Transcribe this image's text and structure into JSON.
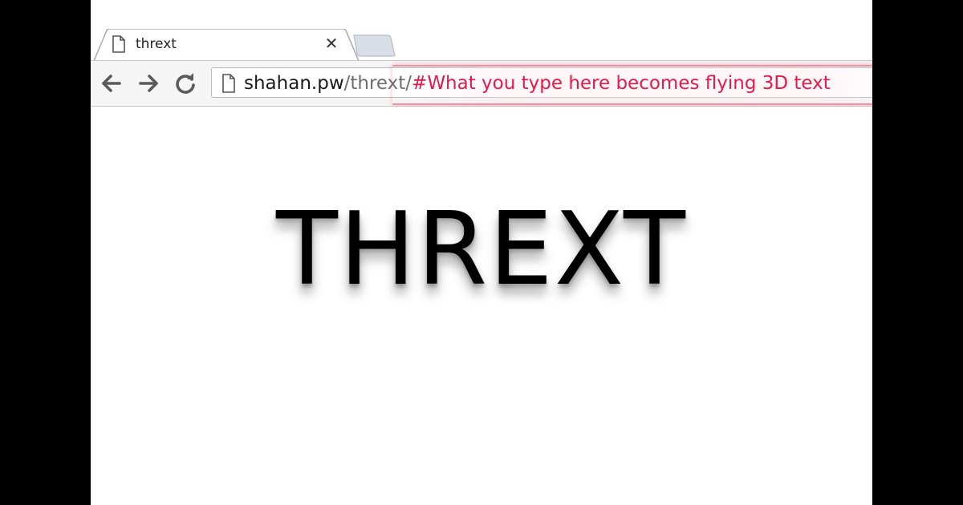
{
  "browser": {
    "tab": {
      "title": "thrext",
      "close_glyph": "✕"
    },
    "icons": {
      "tab_icon": "page-icon",
      "close": "close-icon",
      "back": "back-arrow-icon",
      "forward": "forward-arrow-icon",
      "reload": "reload-icon",
      "omnibox_icon": "page-icon"
    },
    "address": {
      "host": "shahan.pw",
      "path": "/thrext/",
      "fragment": "#What you type here becomes flying 3D text"
    }
  },
  "page": {
    "hero_text": "THREXT"
  },
  "colors": {
    "url_fragment": "#e8194a",
    "url_path": "#6e6e6e",
    "highlight": "#f03c5a",
    "letterbox": "#000000"
  }
}
